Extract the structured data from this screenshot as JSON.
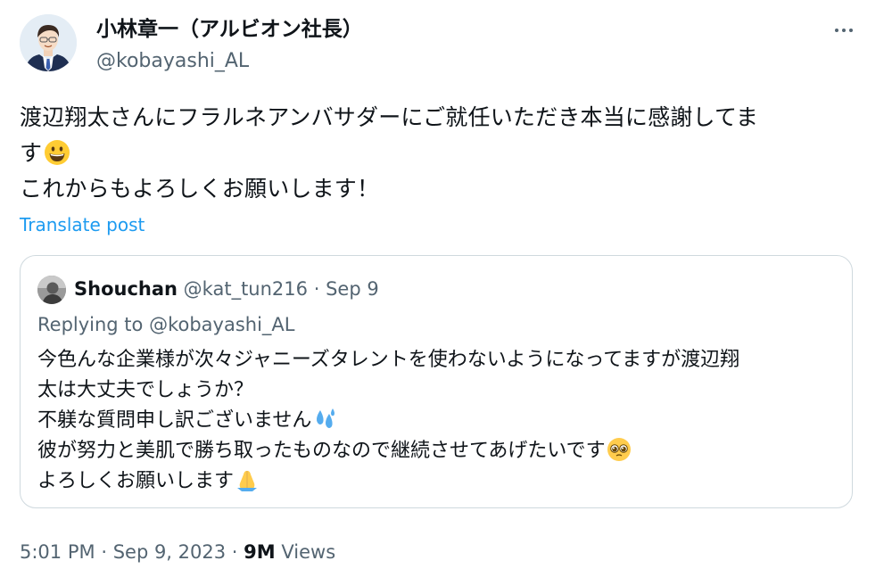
{
  "author": {
    "name": "小林章一（アルビオン社長）",
    "handle": "@kobayashi_AL",
    "avatar_icon": "businessman-avatar-illustration"
  },
  "menu": {
    "icon": "more-horizontal-icon"
  },
  "post": {
    "lines": [
      "渡辺翔太さんにフラルネアンバサダーにご就任いただき本当に感謝してま",
      "す",
      "これからもよろしくお願いします！"
    ],
    "emoji": "grinning-face-emoji",
    "translate_label": "Translate post"
  },
  "quote": {
    "name": "Shouchan",
    "handle": "@kat_tun216",
    "separator": "·",
    "date": "Sep 9",
    "reply_prefix": "Replying to",
    "reply_to": "@kobayashi_AL",
    "lines": [
      "今色んな企業様が次々ジャニーズタレントを使わないようになってますが渡辺翔",
      "太は大丈夫でしょうか？",
      "不躾な質問申し訳ございません",
      "彼が努力と美肌で勝ち取ったものなので継続させてあげたいです",
      "よろしくお願いします"
    ],
    "emojis": [
      "sweat-droplets-emoji",
      "pleading-face-emoji",
      "folded-hands-emoji"
    ]
  },
  "footer": {
    "time": "5:01 PM",
    "sep1": "·",
    "date": "Sep 9, 2023",
    "sep2": "·",
    "views_count": "9M",
    "views_label": "Views"
  },
  "colors": {
    "link": "#1d9bf0",
    "muted": "#536471",
    "text": "#0f1419",
    "border": "#cfd9de"
  }
}
